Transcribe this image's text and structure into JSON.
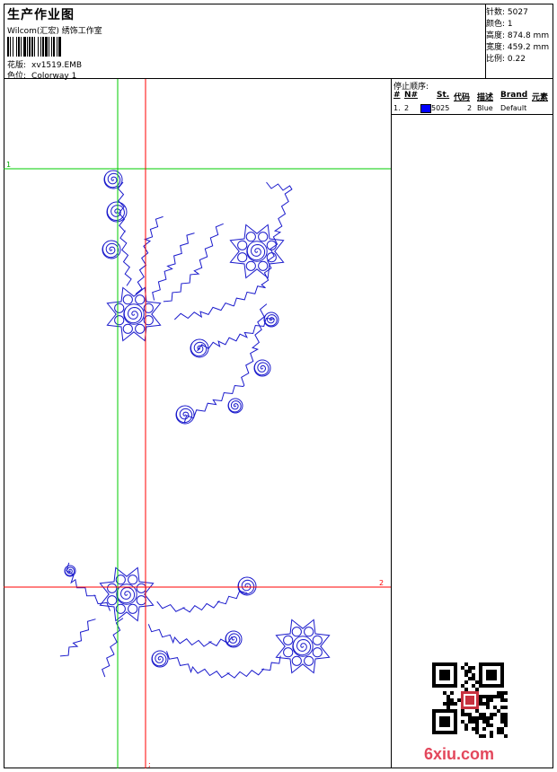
{
  "header": {
    "title": "生产作业图",
    "company": "Wilcom(汇宏) 绣饰工作室",
    "design_label": "花版:",
    "design_value": "xv1519.EMB",
    "colorway_label": "色位:",
    "colorway_value": "Colorway 1"
  },
  "stats": [
    {
      "label": "针数:",
      "value": "5027"
    },
    {
      "label": "颜色:",
      "value": "1"
    },
    {
      "label": "高度:",
      "value": "874.8 mm"
    },
    {
      "label": "宽度:",
      "value": "459.2 mm"
    },
    {
      "label": "比例:",
      "value": "0.22"
    }
  ],
  "stop_sequence": {
    "title": "停止顺序:",
    "columns": [
      "#",
      "N#",
      "St.",
      "代码",
      "描述",
      "Brand",
      "元素"
    ],
    "rows": [
      {
        "index": "1.",
        "needle": "2",
        "stitches": "5025",
        "code": "2",
        "description": "Blue",
        "brand": "Default",
        "color": "#0000ff"
      }
    ]
  },
  "guides": {
    "h1": "1",
    "h2": "2",
    "v_mark": ";"
  },
  "watermark": "6xiu.com",
  "colors": {
    "stitch": "#1a1acc",
    "guide_green": "#00cc00",
    "guide_red": "#ff0000"
  }
}
